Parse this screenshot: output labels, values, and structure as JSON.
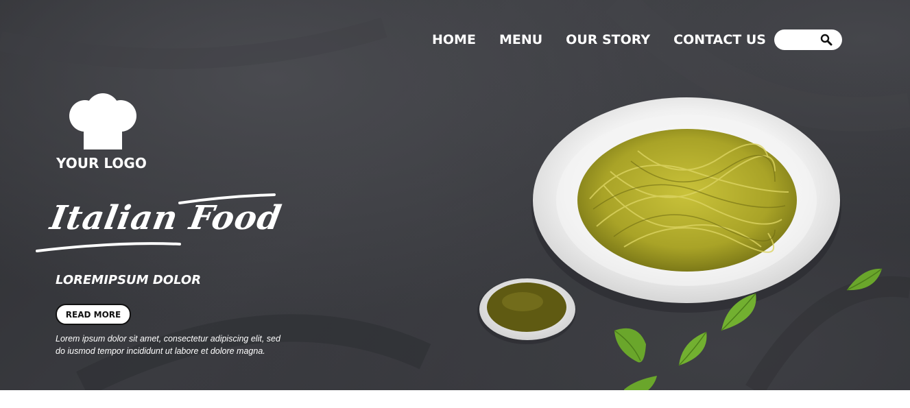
{
  "nav": {
    "items": [
      "HOME",
      "MENU",
      "OUR STORY",
      "CONTACT US"
    ]
  },
  "search": {
    "icon": "search-icon"
  },
  "logo": {
    "text": "YOUR LOGO",
    "icon": "chef-hat-icon"
  },
  "hero": {
    "script_title": "Italian Food",
    "subtitle": "LOREMIPSUM DOLOR",
    "button_label": "READ MORE",
    "description": "Lorem ipsum dolor sit amet, consectetur adipiscing elit, sed do iusmod tempor incididunt ut labore et dolore magna."
  },
  "colors": {
    "background": "#333438",
    "text": "#ffffff",
    "pasta": "#b5b22e",
    "pesto": "#5f5a12",
    "basil": "#6aa62b"
  }
}
